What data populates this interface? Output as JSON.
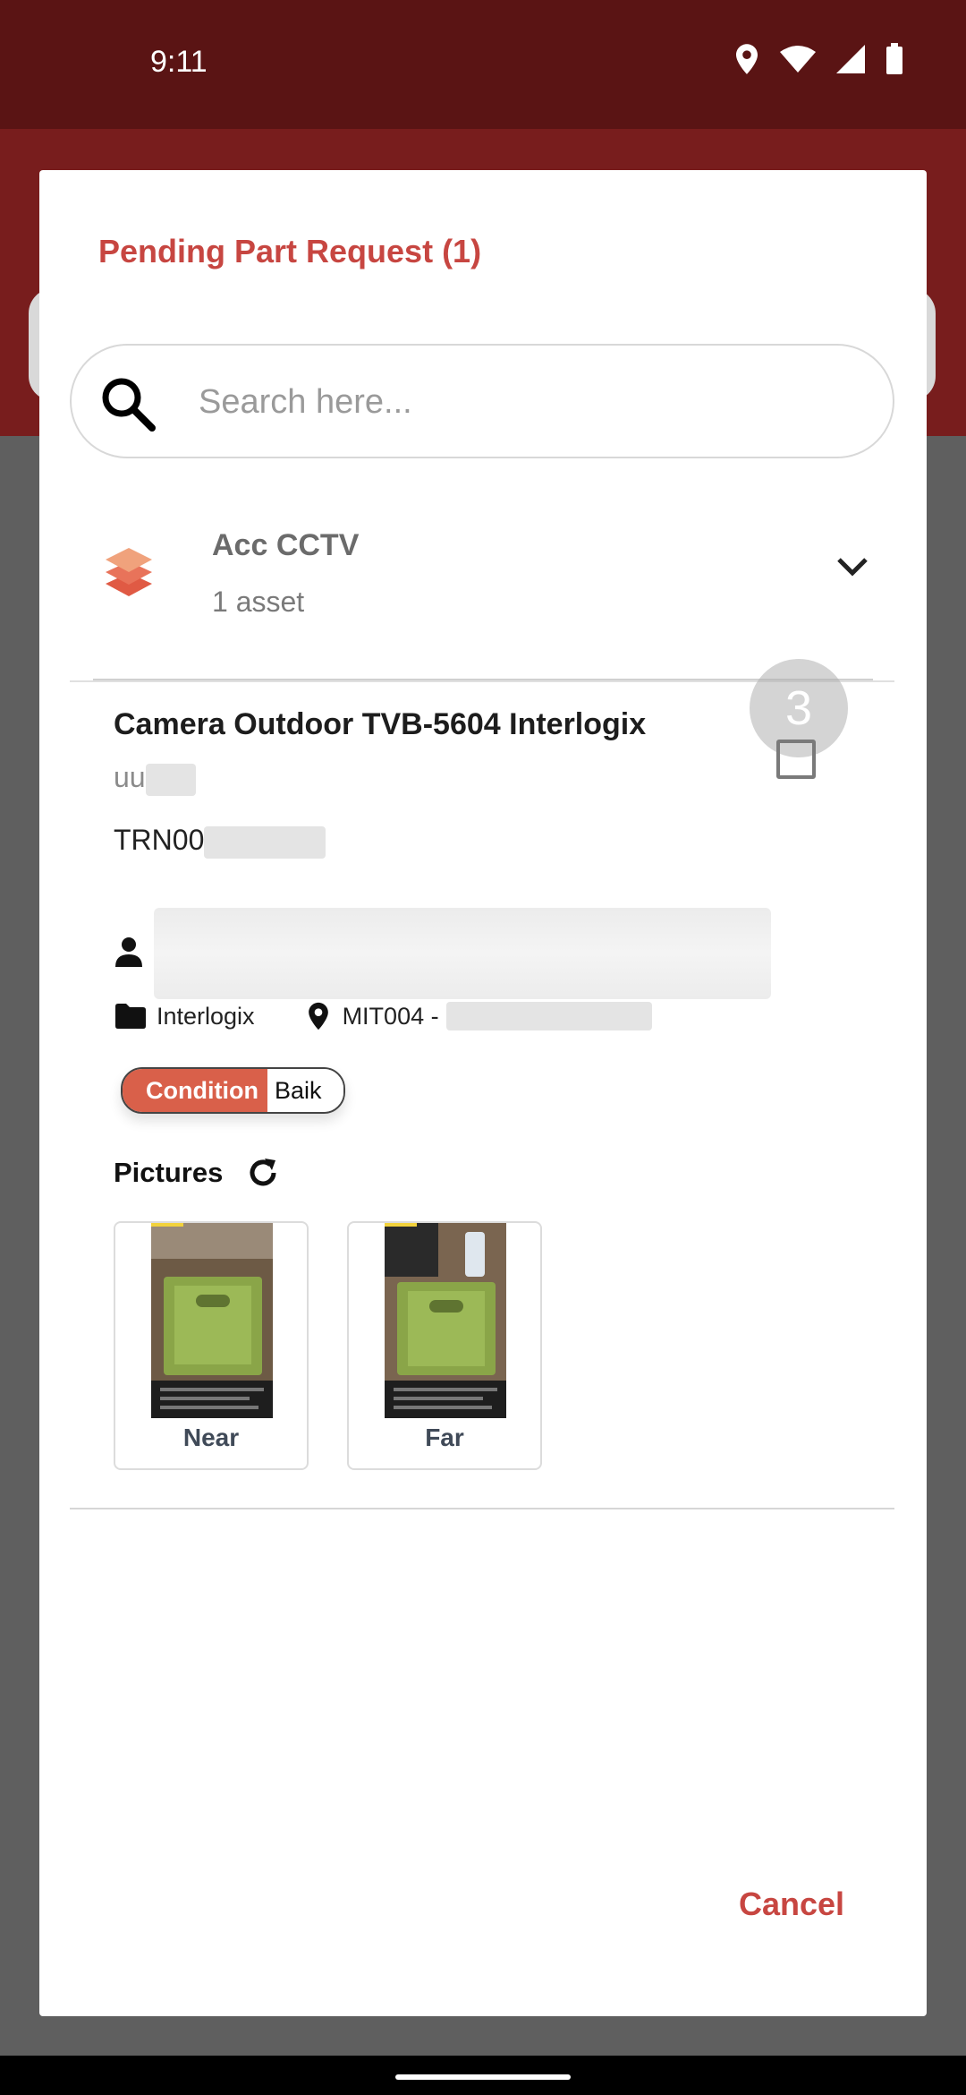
{
  "status_bar": {
    "time": "9:11"
  },
  "dialog": {
    "title": "Pending Part Request (1)",
    "search_placeholder": "Search here...",
    "group": {
      "title": "Acc CCTV",
      "subtitle": "1 asset"
    },
    "asset": {
      "name": "Camera Outdoor TVB-5604 Interlogix",
      "code_prefix": "uu",
      "serial_prefix": "TRN00",
      "brand": "Interlogix",
      "location_prefix": "MIT004 -",
      "condition_label": "Condition",
      "condition_value": "Baik",
      "badge_number": "3"
    },
    "pictures": {
      "title": "Pictures",
      "items": [
        {
          "label": "Near"
        },
        {
          "label": "Far"
        }
      ]
    },
    "cancel_label": "Cancel"
  },
  "colors": {
    "accent": "#c74641",
    "appbar": "#781d1d",
    "statusbar": "#5a1414",
    "condition": "#d9604a"
  }
}
